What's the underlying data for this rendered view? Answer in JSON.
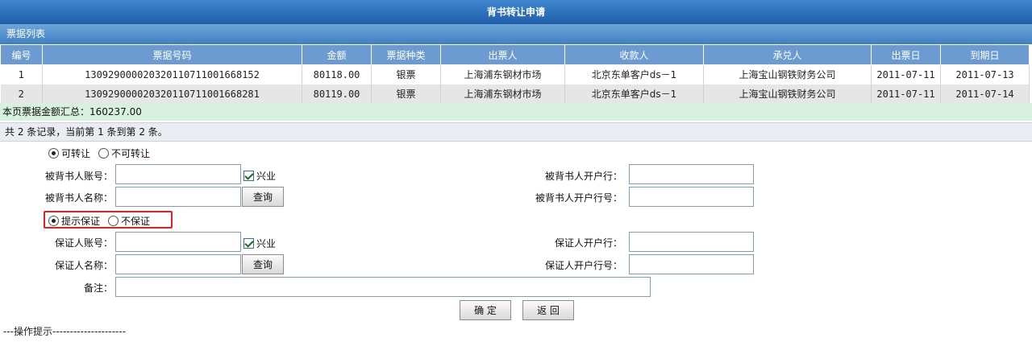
{
  "window_title": "背书转让申请",
  "section_title": "票据列表",
  "table": {
    "headers": [
      "编号",
      "票据号码",
      "金额",
      "票据种类",
      "出票人",
      "收款人",
      "承兑人",
      "出票日",
      "到期日"
    ],
    "rows": [
      [
        "1",
        "130929000020320110711001668152",
        "80118.00",
        "银票",
        "上海浦东钢材市场",
        "北京东单客户ds－1",
        "上海宝山钢铁财务公司",
        "2011-07-11",
        "2011-07-13"
      ],
      [
        "2",
        "130929000020320110711001668281",
        "80119.00",
        "银票",
        "上海浦东钢材市场",
        "北京东单客户ds－1",
        "上海宝山钢铁财务公司",
        "2011-07-11",
        "2011-07-14"
      ]
    ]
  },
  "summary": "本页票据金额汇总：160237.00",
  "record_count": "共 2 条记录，当前第 1 条到第 2 条。",
  "transfer_options": {
    "transferable": "可转让",
    "non_transferable": "不可转让"
  },
  "endorsee": {
    "account_label": "被背书人账号：",
    "account_value": "",
    "same_bank_label": "兴业",
    "name_label": "被背书人名称：",
    "name_value": "",
    "query_label": "查询",
    "bank_label": "被背书人开户行：",
    "bank_value": "",
    "bank_no_label": "被背书人开户行号：",
    "bank_no_value": ""
  },
  "guarantee_options": {
    "guarantee": "提示保证",
    "no_guarantee": "不保证"
  },
  "guarantor": {
    "account_label": "保证人账号：",
    "account_value": "",
    "same_bank_label": "兴业",
    "name_label": "保证人名称：",
    "name_value": "",
    "query_label": "查询",
    "bank_label": "保证人开户行：",
    "bank_value": "",
    "bank_no_label": "保证人开户行号：",
    "bank_no_value": ""
  },
  "remark_label": "备注：",
  "remark_value": "",
  "buttons": {
    "confirm": "确 定",
    "back": "返 回"
  },
  "tips_title": "---操作提示---------------------"
}
